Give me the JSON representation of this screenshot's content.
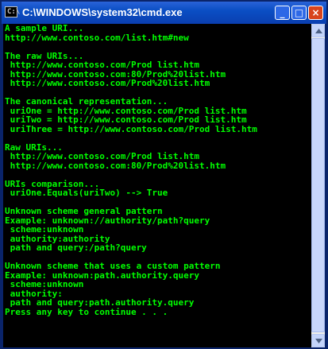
{
  "window": {
    "title": "C:\\WINDOWS\\system32\\cmd.exe",
    "icon_text": "C:\\",
    "buttons": {
      "minimize": "_",
      "maximize": "□",
      "close": "×"
    }
  },
  "console": {
    "lines": [
      "A sample URI...",
      "http://www.contoso.com/list.htm#new",
      "",
      "The raw URIs...",
      " http://www.contoso.com/Prod list.htm",
      " http://www.contoso.com:80/Prod%20list.htm",
      " http://www.contoso.com/Prod%20list.htm",
      "",
      "The canonical representation...",
      " uriOne = http://www.contoso.com/Prod list.htm",
      " uriTwo = http://www.contoso.com/Prod list.htm",
      " uriThree = http://www.contoso.com/Prod list.htm",
      "",
      "Raw URIs...",
      " http://www.contoso.com/Prod list.htm",
      " http://www.contoso.com:80/Prod%20list.htm",
      "",
      "URIs comparison...",
      " uriOne.Equals(uriTwo) --> True",
      "",
      "Unknown scheme general pattern",
      "Example: unknown://authority/path?query",
      " scheme:unknown",
      " authority:authority",
      " path and query:/path?query",
      "",
      "Unknown scheme that uses a custom pattern",
      "Example: unknown:path.authority.query",
      " scheme:unknown",
      " authority:",
      " path and query:path.authority.query",
      "Press any key to continue . . ."
    ]
  },
  "colors": {
    "console_bg": "#000000",
    "console_text": "#00ff00",
    "titlebar": "#0a4ec4"
  }
}
